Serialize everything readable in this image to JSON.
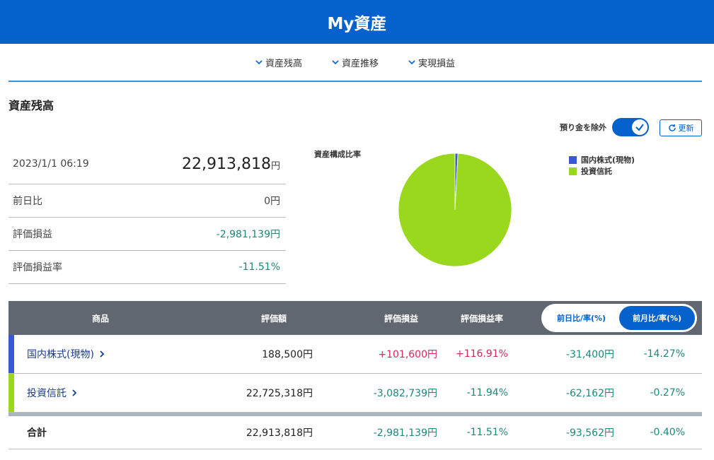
{
  "header": {
    "title": "My資産"
  },
  "nav": [
    {
      "label": "資産残高"
    },
    {
      "label": "資産推移"
    },
    {
      "label": "実現損益"
    }
  ],
  "section": {
    "title": "資産残高"
  },
  "toggle": {
    "label": "預り金を除外",
    "checked": true
  },
  "refresh": {
    "label": "更新"
  },
  "summary": {
    "datetime": "2023/1/1 06:19",
    "total": "22,913,818",
    "unit": "円",
    "rows": [
      {
        "label": "前日比",
        "value": "0円"
      },
      {
        "label": "評価損益",
        "value": "-2,981,139円"
      },
      {
        "label": "評価損益率",
        "value": "-11.51%"
      }
    ]
  },
  "chart_data": {
    "type": "pie",
    "title": "資産構成比率",
    "categories": [
      "国内株式(現物)",
      "投資信託"
    ],
    "values": [
      188500,
      22725318
    ],
    "colors": [
      "#3a57d8",
      "#9ad81e"
    ],
    "legend_position": "top-right"
  },
  "table": {
    "headers": {
      "product": "商品",
      "value": "評価額",
      "gain": "評価損益",
      "gain_rate": "評価損益率"
    },
    "segment": {
      "day": "前日比/率(%)",
      "month": "前月比/率(%)",
      "active": "month"
    },
    "rows": [
      {
        "name": "国内株式(現物)",
        "color": "#3a57d8",
        "value": "188,500円",
        "gain": "+101,600円",
        "gain_rate": "+116.91%",
        "change": "-31,400円",
        "change_rate": "-14.27%",
        "gain_sign": "pos"
      },
      {
        "name": "投資信託",
        "color": "#9ad81e",
        "value": "22,725,318円",
        "gain": "-3,082,739円",
        "gain_rate": "-11.94%",
        "change": "-62,162円",
        "change_rate": "-0.27%",
        "gain_sign": "neg"
      }
    ],
    "total": {
      "name": "合計",
      "value": "22,913,818円",
      "gain": "-2,981,139円",
      "gain_rate": "-11.51%",
      "change": "-93,562円",
      "change_rate": "-0.40%"
    }
  }
}
